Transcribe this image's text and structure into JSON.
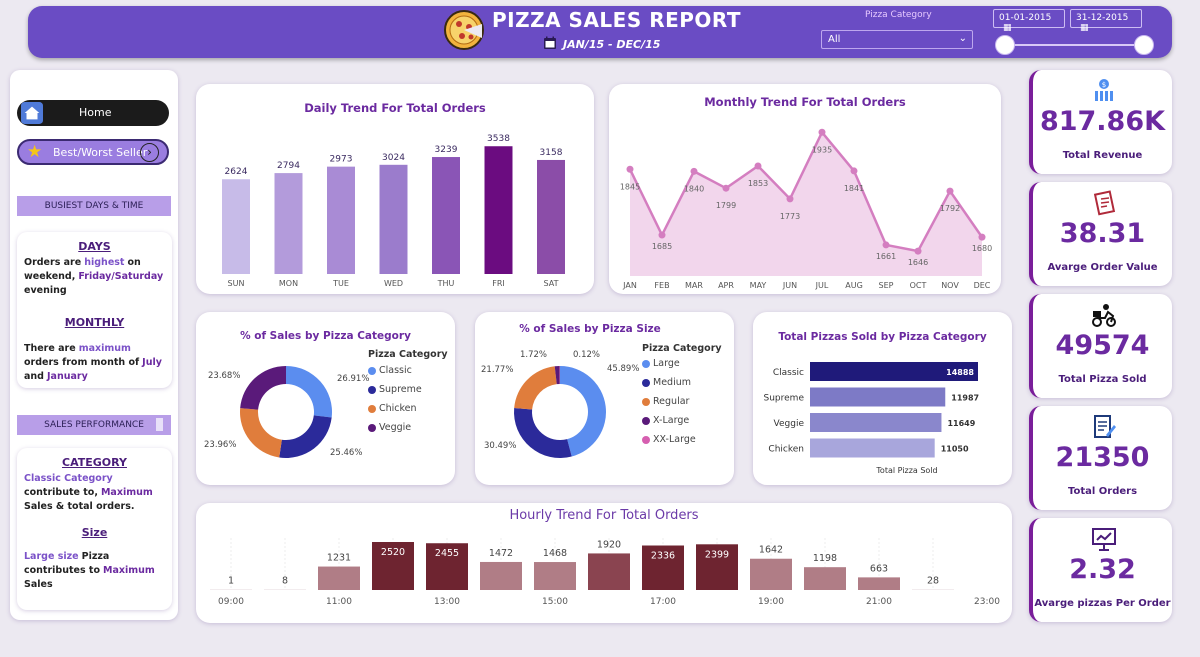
{
  "header": {
    "title": "PIZZA SALES REPORT",
    "date_range": "JAN/15 - DEC/15",
    "filter_label": "Pizza Category",
    "filter_value": "All",
    "start_date": "01-01-2015",
    "end_date": "31-12-2015"
  },
  "sidebar": {
    "home_label": "Home",
    "best_worst_label": "Best/Worst Seller",
    "busiest_tag": "BUSIEST DAYS & TIME",
    "days_heading": "DAYS",
    "days_text_1": "Orders are",
    "days_text_hl": "highest",
    "days_text_2": "on weekend,",
    "days_text_hl2": "Friday/Saturday",
    "days_text_3": "evening",
    "monthly_heading": "MONTHLY",
    "monthly_text_1": "There are",
    "monthly_text_hl": "maximum",
    "monthly_text_2": "orders from month of",
    "monthly_text_hl2": "July",
    "monthly_text_3": "and",
    "monthly_text_hl3": "January",
    "sales_tag": "SALES PERFORMANCE",
    "category_heading": "CATEGORY",
    "category_text_hl": "Classic Category",
    "category_text_1": "contribute to,",
    "category_text_hl2": "Maximum",
    "category_text_2": "Sales & total orders.",
    "size_heading": "Size",
    "size_text_hl": "Large size",
    "size_text_1": "Pizza contributes to",
    "size_text_hl2": "Maximum",
    "size_text_2": "Sales"
  },
  "kpis": [
    {
      "value": "817.86K",
      "label": "Total Revenue",
      "icon": "money-icon"
    },
    {
      "value": "38.31",
      "label": "Avarge Order Value",
      "icon": "receipt-icon"
    },
    {
      "value": "49574",
      "label": "Total Pizza Sold",
      "icon": "delivery-icon"
    },
    {
      "value": "21350",
      "label": "Total Orders",
      "icon": "order-doc-icon"
    },
    {
      "value": "2.32",
      "label": "Avarge pizzas Per Order",
      "icon": "presentation-chart-icon"
    }
  ],
  "colors": {
    "header": "#6a4cc4",
    "accent": "#6b2aa0",
    "classic": "#5b8def",
    "supreme": "#2b2a9a",
    "chicken": "#e07d3c",
    "veggie": "#5a1a7a",
    "hourly_dark": "#6e2430",
    "hourly_light": "#b07d86"
  },
  "chart_data": [
    {
      "type": "bar",
      "title": "Daily Trend For Total Orders",
      "categories": [
        "SUN",
        "MON",
        "TUE",
        "WED",
        "THU",
        "FRI",
        "SAT"
      ],
      "values": [
        2624,
        2794,
        2973,
        3024,
        3239,
        3538,
        3158
      ],
      "ylim": [
        0,
        3600
      ]
    },
    {
      "type": "area",
      "title": "Monthly Trend For Total Orders",
      "categories": [
        "JAN",
        "FEB",
        "MAR",
        "APR",
        "MAY",
        "JUN",
        "JUL",
        "AUG",
        "SEP",
        "OCT",
        "NOV",
        "DEC"
      ],
      "values": [
        1845,
        1685,
        1840,
        1799,
        1853,
        1773,
        1935,
        1841,
        1661,
        1646,
        1792,
        1680
      ]
    },
    {
      "type": "pie",
      "title": "% of Sales by Pizza Category",
      "legend_title": "Pizza Category",
      "categories": [
        "Classic",
        "Supreme",
        "Chicken",
        "Veggie"
      ],
      "values": [
        26.91,
        25.46,
        23.96,
        23.68
      ],
      "labels": [
        "26.91%",
        "25.46%",
        "23.96%",
        "23.68%"
      ]
    },
    {
      "type": "pie",
      "title": "% of Sales by Pizza Size",
      "legend_title": "Pizza Category",
      "categories": [
        "Large",
        "Medium",
        "Regular",
        "X-Large",
        "XX-Large"
      ],
      "values": [
        45.89,
        30.49,
        21.77,
        1.72,
        0.12
      ],
      "labels": [
        "45.89%",
        "30.49%",
        "21.77%",
        "1.72%",
        "0.12%"
      ]
    },
    {
      "type": "bar",
      "orientation": "horizontal",
      "title": "Total Pizzas Sold by Pizza Category",
      "xlabel": "Total Pizza Sold",
      "categories": [
        "Classic",
        "Supreme",
        "Veggie",
        "Chicken"
      ],
      "values": [
        14888,
        11987,
        11649,
        11050
      ]
    },
    {
      "type": "bar",
      "title": "Hourly Trend For Total Orders",
      "categories": [
        9,
        10,
        11,
        12,
        13,
        14,
        15,
        16,
        17,
        18,
        19,
        20,
        21,
        22,
        23
      ],
      "tick_labels": [
        "09:00",
        "11:00",
        "13:00",
        "15:00",
        "17:00",
        "19:00",
        "21:00",
        "23:00"
      ],
      "values": [
        1,
        8,
        1231,
        2520,
        2455,
        1472,
        1468,
        1920,
        2336,
        2399,
        1642,
        1198,
        663,
        28
      ]
    }
  ]
}
